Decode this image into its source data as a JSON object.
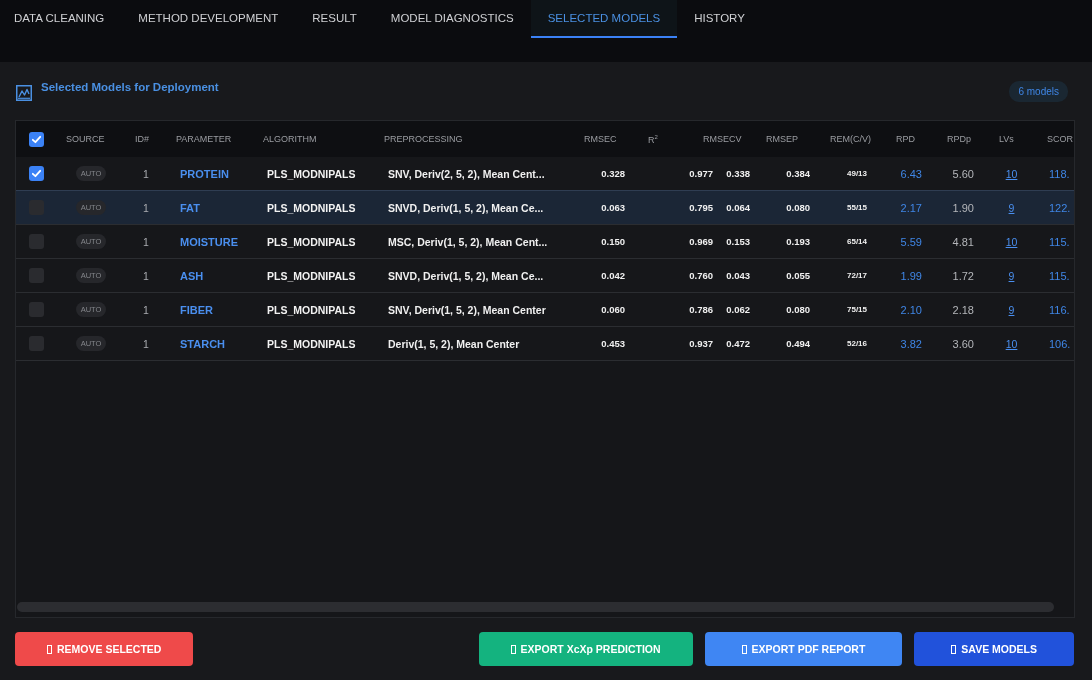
{
  "tabs": [
    {
      "label": "DATA CLEANING",
      "selected": false
    },
    {
      "label": "METHOD DEVELOPMENT",
      "selected": false
    },
    {
      "label": "RESULT",
      "selected": false
    },
    {
      "label": "MODEL DIAGNOSTICS",
      "selected": false
    },
    {
      "label": "SELECTED MODELS",
      "selected": true
    },
    {
      "label": "HISTORY",
      "selected": false
    }
  ],
  "panel": {
    "title": "Selected Models for Deployment",
    "count_badge": "6 models"
  },
  "table": {
    "select_all_checked": true,
    "columns": [
      "SOURCE",
      "ID#",
      "PARAMETER",
      "ALGORITHM",
      "PREPROCESSING",
      "RMSEC",
      "R$^{2}$",
      "RMSECV",
      "RMSEP",
      "REM(C/V)",
      "RPD",
      "RPDp",
      "LVs",
      "SCOR"
    ],
    "rows": [
      {
        "checked": true,
        "highlighted": false,
        "source": "AUTO",
        "id": "1",
        "parameter": "PROTEIN",
        "algorithm": "PLS_MODNIPALS",
        "preprocessing": "SNV, Deriv(2, 5, 2), Mean Cent...",
        "rmsec": "0.328",
        "r2": "0.977",
        "rmsecv": "0.338",
        "rmsep": "0.384",
        "rem": "49/13",
        "rpd": "6.43",
        "rpdp": "5.60",
        "lvs": "10",
        "score": "118."
      },
      {
        "checked": false,
        "highlighted": true,
        "source": "AUTO",
        "id": "1",
        "parameter": "FAT",
        "algorithm": "PLS_MODNIPALS",
        "preprocessing": "SNVD, Deriv(1, 5, 2), Mean Ce...",
        "rmsec": "0.063",
        "r2": "0.795",
        "rmsecv": "0.064",
        "rmsep": "0.080",
        "rem": "55/15",
        "rpd": "2.17",
        "rpdp": "1.90",
        "lvs": "9",
        "score": "122."
      },
      {
        "checked": false,
        "highlighted": false,
        "source": "AUTO",
        "id": "1",
        "parameter": "MOISTURE",
        "algorithm": "PLS_MODNIPALS",
        "preprocessing": "MSC, Deriv(1, 5, 2), Mean Cent...",
        "rmsec": "0.150",
        "r2": "0.969",
        "rmsecv": "0.153",
        "rmsep": "0.193",
        "rem": "65/14",
        "rpd": "5.59",
        "rpdp": "4.81",
        "lvs": "10",
        "score": "115."
      },
      {
        "checked": false,
        "highlighted": false,
        "source": "AUTO",
        "id": "1",
        "parameter": "ASH",
        "algorithm": "PLS_MODNIPALS",
        "preprocessing": "SNVD, Deriv(1, 5, 2), Mean Ce...",
        "rmsec": "0.042",
        "r2": "0.760",
        "rmsecv": "0.043",
        "rmsep": "0.055",
        "rem": "72/17",
        "rpd": "1.99",
        "rpdp": "1.72",
        "lvs": "9",
        "score": "115."
      },
      {
        "checked": false,
        "highlighted": false,
        "source": "AUTO",
        "id": "1",
        "parameter": "FIBER",
        "algorithm": "PLS_MODNIPALS",
        "preprocessing": "SNV, Deriv(1, 5, 2), Mean Center",
        "rmsec": "0.060",
        "r2": "0.786",
        "rmsecv": "0.062",
        "rmsep": "0.080",
        "rem": "75/15",
        "rpd": "2.10",
        "rpdp": "2.18",
        "lvs": "9",
        "score": "116."
      },
      {
        "checked": false,
        "highlighted": false,
        "source": "AUTO",
        "id": "1",
        "parameter": "STARCH",
        "algorithm": "PLS_MODNIPALS",
        "preprocessing": "Deriv(1, 5, 2), Mean Center",
        "rmsec": "0.453",
        "r2": "0.937",
        "rmsecv": "0.472",
        "rmsep": "0.494",
        "rem": "52/16",
        "rpd": "3.82",
        "rpdp": "3.60",
        "lvs": "10",
        "score": "106."
      }
    ]
  },
  "buttons": [
    {
      "label": "REMOVE SELECTED",
      "kind": "danger"
    },
    {
      "label": "EXPORT XcXp PREDICTION",
      "kind": "success"
    },
    {
      "label": "EXPORT PDF REPORT",
      "kind": "primary"
    },
    {
      "label": "SAVE MODELS",
      "kind": "save"
    }
  ]
}
